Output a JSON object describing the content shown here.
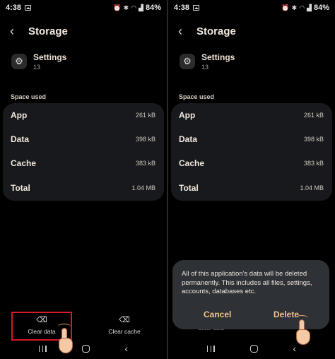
{
  "screens": [
    {
      "status": {
        "time": "4:38",
        "battery": "84%"
      },
      "header": {
        "title": "Storage"
      },
      "app": {
        "name": "Settings",
        "version": "13"
      },
      "section_label": "Space used",
      "rows": [
        {
          "label": "App",
          "value": "261 kB"
        },
        {
          "label": "Data",
          "value": "398 kB"
        },
        {
          "label": "Cache",
          "value": "383 kB"
        },
        {
          "label": "Total",
          "value": "1.04 MB"
        }
      ],
      "actions": {
        "clear_data": "Clear data",
        "clear_cache": "Clear cache"
      }
    },
    {
      "status": {
        "time": "4:38",
        "battery": "84%"
      },
      "header": {
        "title": "Storage"
      },
      "app": {
        "name": "Settings",
        "version": "13"
      },
      "section_label": "Space used",
      "rows": [
        {
          "label": "App",
          "value": "261 kB"
        },
        {
          "label": "Data",
          "value": "398 kB"
        },
        {
          "label": "Cache",
          "value": "383 kB"
        },
        {
          "label": "Total",
          "value": "1.04 MB"
        }
      ],
      "dialog": {
        "message": "All of this application's data will be deleted permanently. This includes all files, settings, accounts, databases etc.",
        "cancel": "Cancel",
        "delete": "Delete"
      },
      "partial_label": "Clear data"
    }
  ],
  "colors": {
    "highlight": "#d71920",
    "dialog_button": "#f3c48f",
    "card": "#17191c"
  },
  "icons": [
    "image-icon",
    "alarm-icon",
    "bluetooth-icon",
    "wifi-icon",
    "signal-icon",
    "back-arrow-icon",
    "settings-app-icon",
    "clear-data-icon",
    "clear-cache-icon",
    "pointing-hand-icon"
  ]
}
